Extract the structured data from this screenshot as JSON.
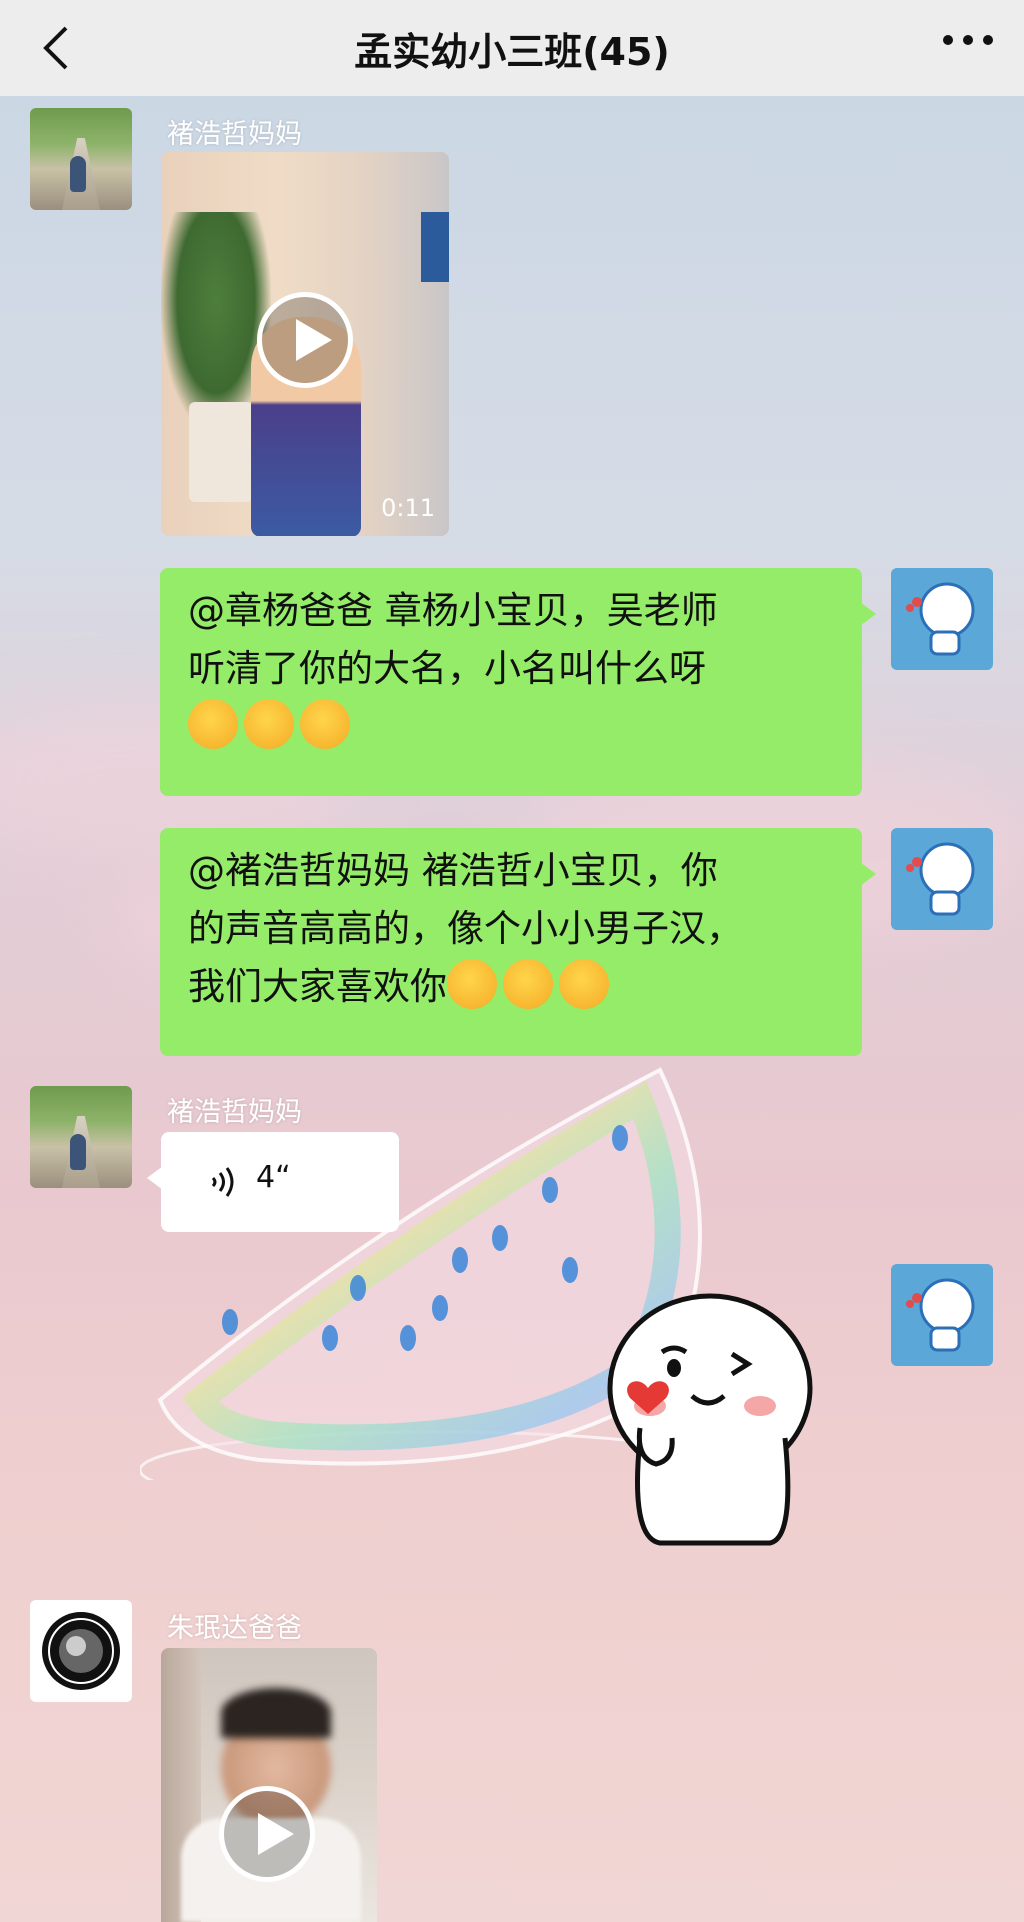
{
  "header": {
    "title": "孟实幼小三班(45)"
  },
  "messages": [
    {
      "sender": "褚浩哲妈妈",
      "video_duration": "0:11"
    },
    {
      "text_lines": [
        "@章杨爸爸  章杨小宝贝，吴老师",
        "听清了你的大名，小名叫什么呀"
      ]
    },
    {
      "text_lines": [
        "@褚浩哲妈妈  褚浩哲小宝贝，你",
        "的声音高高的，像个小小男子汉，",
        "我们大家喜欢你"
      ]
    },
    {
      "sender": "褚浩哲妈妈",
      "voice_length": "4“"
    },
    {
      "sender": "朱珉达爸爸"
    }
  ],
  "colors": {
    "my_bubble": "#95ec69",
    "header_bg": "#ededed"
  }
}
